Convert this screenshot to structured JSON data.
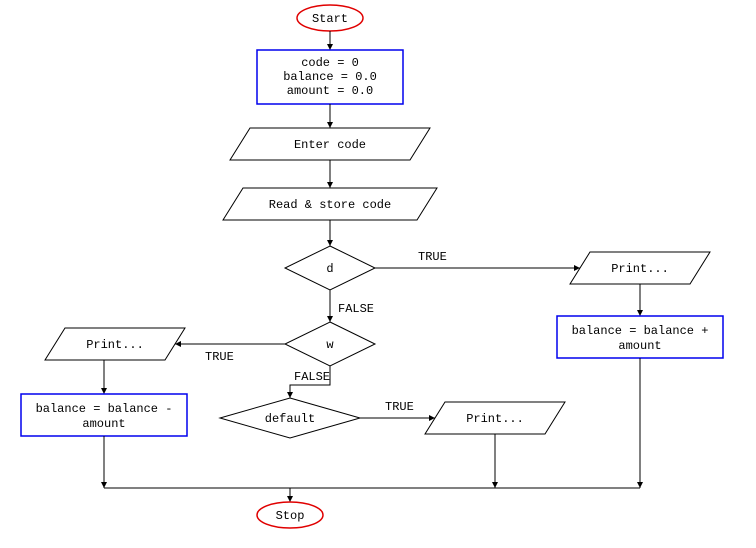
{
  "terminators": {
    "start": "Start",
    "stop": "Stop"
  },
  "process": {
    "init_line1": "code = 0",
    "init_line2": "balance = 0.0",
    "init_line3": "amount = 0.0",
    "balance_plus": "balance = balance +",
    "balance_plus_operand": "amount",
    "balance_minus": "balance = balance -",
    "balance_minus_operand": "amount"
  },
  "io": {
    "enter_code": "Enter code",
    "read_store_code": "Read & store code",
    "print_d": "Print...",
    "print_w": "Print...",
    "print_default": "Print..."
  },
  "decisions": {
    "d": "d",
    "w": "w",
    "default": "default"
  },
  "labels": {
    "true_d": "TRUE",
    "false_d": "FALSE",
    "true_w": "TRUE",
    "false_w": "FALSE",
    "true_default": "TRUE"
  },
  "chart_data": {
    "type": "flowchart",
    "nodes": [
      {
        "id": "start",
        "kind": "terminator",
        "text": "Start",
        "color": "red"
      },
      {
        "id": "init",
        "kind": "process",
        "text": [
          "code = 0",
          "balance = 0.0",
          "amount = 0.0"
        ],
        "color": "blue"
      },
      {
        "id": "enter_code",
        "kind": "io",
        "text": "Enter code"
      },
      {
        "id": "read_store_code",
        "kind": "io",
        "text": "Read & store code"
      },
      {
        "id": "dec_d",
        "kind": "decision",
        "text": "d"
      },
      {
        "id": "dec_w",
        "kind": "decision",
        "text": "w"
      },
      {
        "id": "dec_default",
        "kind": "decision",
        "text": "default"
      },
      {
        "id": "print_d",
        "kind": "io",
        "text": "Print..."
      },
      {
        "id": "print_w",
        "kind": "io",
        "text": "Print..."
      },
      {
        "id": "print_default",
        "kind": "io",
        "text": "Print..."
      },
      {
        "id": "balance_plus",
        "kind": "process",
        "text": [
          "balance = balance +",
          "amount"
        ],
        "color": "blue"
      },
      {
        "id": "balance_minus",
        "kind": "process",
        "text": [
          "balance = balance -",
          "amount"
        ],
        "color": "blue"
      },
      {
        "id": "stop",
        "kind": "terminator",
        "text": "Stop",
        "color": "red"
      }
    ],
    "edges": [
      {
        "from": "start",
        "to": "init"
      },
      {
        "from": "init",
        "to": "enter_code"
      },
      {
        "from": "enter_code",
        "to": "read_store_code"
      },
      {
        "from": "read_store_code",
        "to": "dec_d"
      },
      {
        "from": "dec_d",
        "to": "print_d",
        "label": "TRUE"
      },
      {
        "from": "dec_d",
        "to": "dec_w",
        "label": "FALSE"
      },
      {
        "from": "dec_w",
        "to": "print_w",
        "label": "TRUE"
      },
      {
        "from": "dec_w",
        "to": "dec_default",
        "label": "FALSE"
      },
      {
        "from": "dec_default",
        "to": "print_default",
        "label": "TRUE"
      },
      {
        "from": "print_d",
        "to": "balance_plus"
      },
      {
        "from": "print_w",
        "to": "balance_minus"
      },
      {
        "from": "balance_plus",
        "to": "stop"
      },
      {
        "from": "balance_minus",
        "to": "stop"
      },
      {
        "from": "print_default",
        "to": "stop"
      }
    ]
  }
}
